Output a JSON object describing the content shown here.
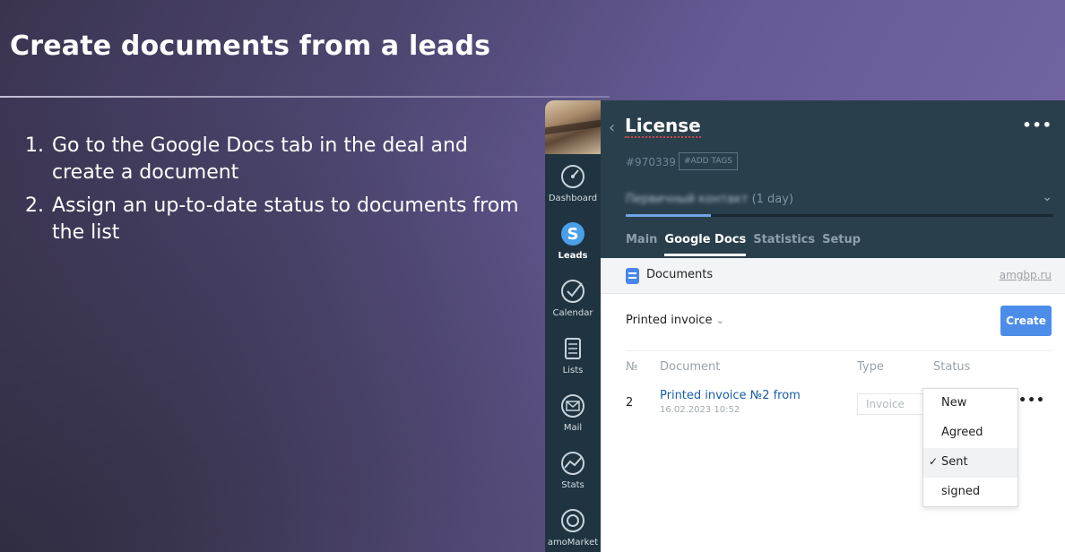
{
  "slide": {
    "title": "Create documents from a leads",
    "steps": [
      {
        "num": "1.",
        "text": "Go to the Google Docs tab in the deal and create a document"
      },
      {
        "num": "2.",
        "text": "Assign an up-to-date status to documents from the list"
      }
    ]
  },
  "nav": {
    "items": [
      {
        "label": "Dashboard",
        "icon": "dashboard-gauge-icon"
      },
      {
        "label": "Leads",
        "icon": "dollar-icon"
      },
      {
        "label": "Calendar",
        "icon": "check-circle-icon"
      },
      {
        "label": "Lists",
        "icon": "list-icon"
      },
      {
        "label": "Mail",
        "icon": "mail-icon"
      },
      {
        "label": "Stats",
        "icon": "stats-icon"
      },
      {
        "label": "amoMarket",
        "icon": "market-icon"
      }
    ]
  },
  "lead": {
    "back_icon": "chevron-left-icon",
    "title": "License",
    "more_icon": "ellipsis-icon",
    "id": "#970339",
    "tag_button": "#ADD TAGS",
    "pipeline_stage": "Первичный контакт",
    "pipeline_duration": "(1 day)",
    "progress": 0.2,
    "tabs": [
      "Main",
      "Google Docs",
      "Statistics",
      "Setup"
    ],
    "active_tab": "Google Docs"
  },
  "docs": {
    "section_label": "Documents",
    "site_link": "amgbp.ru",
    "template_select": "Printed invoice",
    "create_button": "Create",
    "columns": {
      "num": "№",
      "document": "Document",
      "type": "Type",
      "status": "Status"
    },
    "rows": [
      {
        "num": "2",
        "document": "Printed invoice №2 from 16.02.2023",
        "date": "16.02.2023 10:52",
        "type": "Invoice"
      }
    ],
    "status_options": [
      "New",
      "Agreed",
      "Sent",
      "signed"
    ],
    "selected_status": "Sent"
  },
  "colors": {
    "accent": "#4c8de9",
    "header_bg": "#2a3f4c",
    "nav_bg": "#1f3340"
  }
}
